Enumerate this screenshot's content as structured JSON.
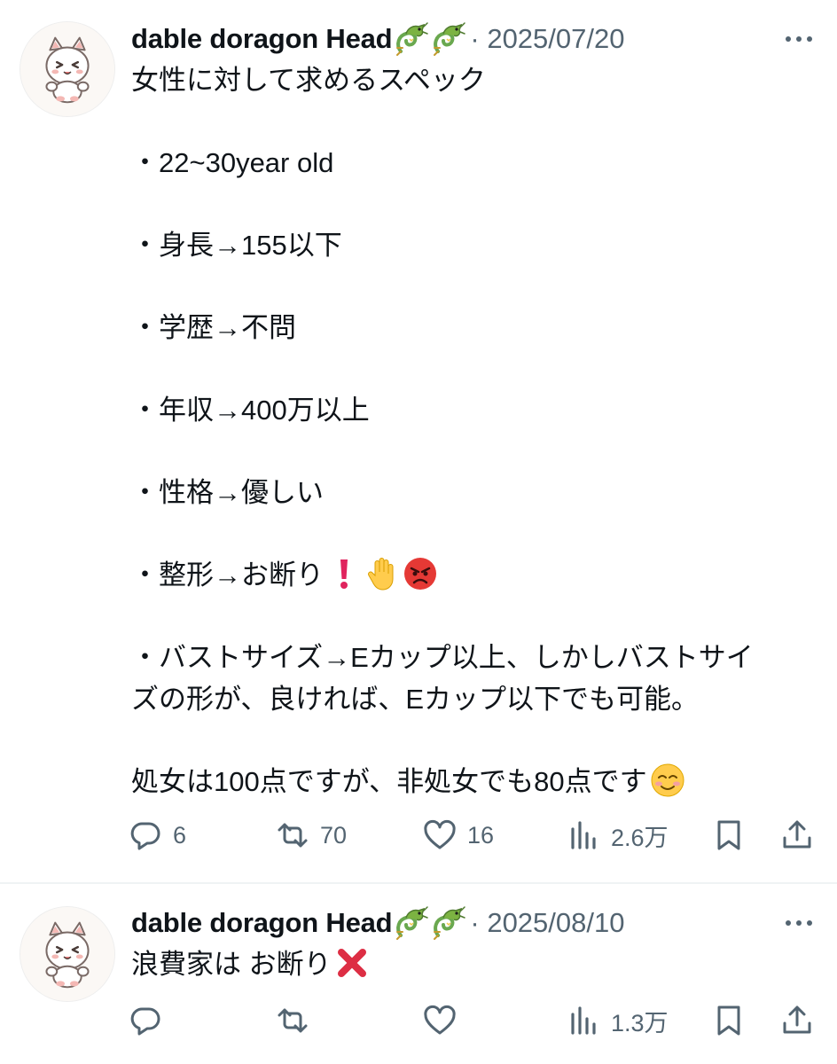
{
  "colors": {
    "text": "#0f1419",
    "muted": "#536471",
    "divider": "#eff3f4",
    "danger": "#e0245e"
  },
  "tweets": [
    {
      "author": {
        "name": "dable doragon Head",
        "name_emoji": [
          "dragon-icon",
          "dragon-icon"
        ],
        "avatar": "cat-avatar"
      },
      "date": "· 2025/07/20",
      "body_lines": [
        "女性に対して求めるスペック",
        "",
        "・22~30year old",
        "",
        "・身長→155以下",
        "",
        "・学歴→不問",
        "",
        "・年収→400万以上",
        "",
        "・性格→優しい",
        "",
        "・整形→お断り",
        "",
        "・バストサイズ→Eカップ以上、しかしバストサイ",
        "ズの形が、良ければ、Eカップ以下でも可能。",
        "",
        "処女は100点ですが、非処女でも80点です"
      ],
      "inline_emoji": {
        "line12": [
          "exclamation-icon",
          "raised-hand-icon",
          "angry-face-icon"
        ],
        "line17": [
          "smiling-face-icon"
        ]
      },
      "stats": {
        "replies": "6",
        "reposts": "70",
        "likes": "16",
        "views": "2.6万"
      }
    },
    {
      "author": {
        "name": "dable doragon Head",
        "name_emoji": [
          "dragon-icon",
          "dragon-icon"
        ],
        "avatar": "cat-avatar"
      },
      "date": "· 2025/08/10",
      "body_lines": [
        "浪費家は お断り"
      ],
      "inline_emoji": {
        "line0": [
          "cross-mark-icon"
        ]
      },
      "stats": {
        "replies": "",
        "reposts": "",
        "likes": "",
        "views": "1.3万"
      }
    }
  ]
}
